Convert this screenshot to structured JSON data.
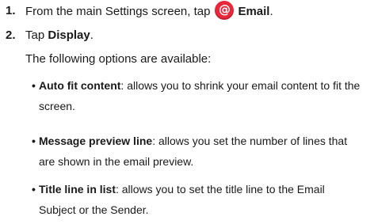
{
  "steps": [
    {
      "number": "1.",
      "text_before": "From the main Settings screen, tap",
      "icon_glyph": "@",
      "icon_name": "email-icon",
      "icon_color": "#e8283a",
      "bold": "Email",
      "text_after": "."
    },
    {
      "number": "2.",
      "text_before": "Tap",
      "bold": "Display",
      "text_after": "."
    }
  ],
  "intro": "The following options are available:",
  "bullet_char": "•",
  "options": [
    {
      "term": "Auto fit content",
      "description": ": allows you to shrink your email content to fit the screen."
    },
    {
      "term": "Message preview line",
      "description": ": allows you set the number of lines that are shown in the email preview."
    },
    {
      "term": "Title line in list",
      "description": ": allows you to set the title line to the Email Subject or the Sender."
    }
  ]
}
